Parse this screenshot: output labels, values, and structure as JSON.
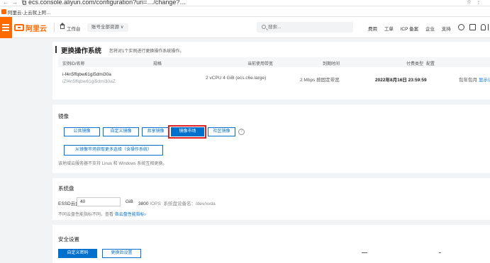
{
  "browser": {
    "url": "ecs.console.aliyun.com/configuration?uri=…/change?…",
    "bookmark": "阿里云-上云就上阿…"
  },
  "topbar": {
    "brand": "阿里云",
    "workbench": "工作台",
    "region": "账号全部资源 ∨",
    "search_placeholder": "搜索...",
    "links": [
      "费用",
      "工单",
      "ICP 备案",
      "企业",
      "支持"
    ]
  },
  "header": {
    "title": "更换操作系统",
    "subtitle": "您将对1个实例进行更换操作系统操作。",
    "columns": [
      "实例ID/名称",
      "规格",
      "当前使用带宽",
      "到期时间",
      "付费类型",
      "配置"
    ],
    "row": {
      "id": "i-f4n5ffqbw61gi5dmi30a",
      "name": "iZf4n5ffqbw61gi5dmi30aZ",
      "spec": "2 vCPU 4 GiB (ecs.c6e.large)",
      "bandwidth": "2 Mbps 按固定带宽",
      "expire": "2022年8月16日 23:59:59",
      "pay": "包年包月",
      "link": "显示详细配置"
    }
  },
  "image": {
    "label": "镜像",
    "tabs": [
      "公共镜像",
      "自定义镜像",
      "共享镜像",
      "镜像市场",
      "社区镜像"
    ],
    "active_tab": "镜像市场",
    "more_button": "从镜像市场获取更多选择（含操作系统）",
    "note": "该地域云服务器不支持 Linux 和 Windows 系统互相更换。"
  },
  "disk": {
    "label": "系统盘",
    "type": "ESSD云盘",
    "size": "40",
    "unit": "GiB",
    "iops": "3800",
    "iops_label": "IOPS",
    "device": "系统盘设备名：/dev/xvda",
    "note_prefix": "不同云盘性能指标不同，查看",
    "note_link": "各云盘性能指标›"
  },
  "security": {
    "label": "安全设置",
    "btn_custom": "自定义密码",
    "btn_later": "更换后设置"
  }
}
